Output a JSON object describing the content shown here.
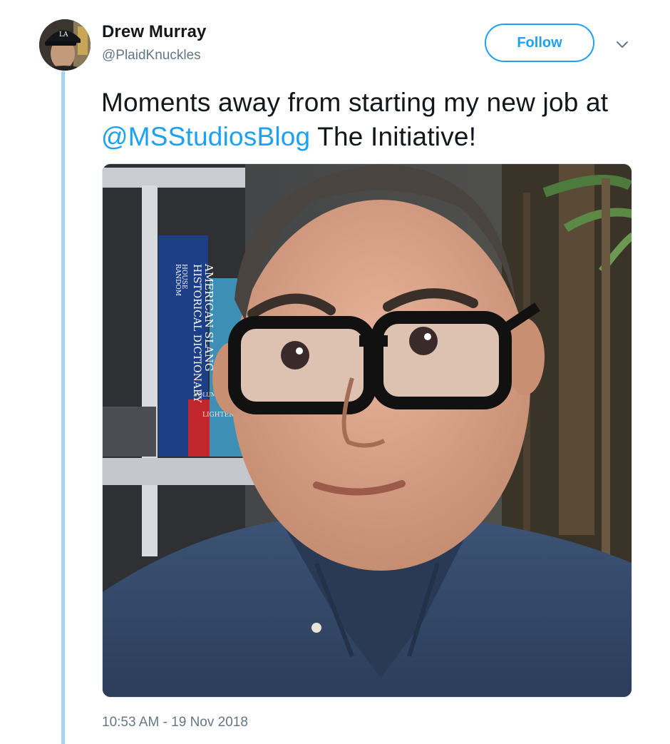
{
  "author": {
    "display_name": "Drew Murray",
    "handle": "@PlaidKnuckles"
  },
  "actions": {
    "follow_label": "Follow"
  },
  "tweet": {
    "text_part1": "Moments away from starting my new job at ",
    "mention": "@MSStudiosBlog",
    "text_part2": " The Initiative!",
    "timestamp": "10:53 AM - 19 Nov 2018"
  },
  "photo": {
    "book_spine": {
      "publisher_line1": "RANDOM",
      "publisher_line2": "HOUSE",
      "title_line1": "HISTORICAL DICTIONARY",
      "title_line2": "AMERICAN SLANG",
      "volume": "VOLUME I A–G",
      "author": "LIGHTER"
    }
  },
  "colors": {
    "accent": "#1da1f2",
    "thread_line": "#a7d4f3",
    "secondary_text": "#657786",
    "primary_text": "#14171a"
  },
  "icons": {
    "caret": "chevron-down-icon"
  }
}
